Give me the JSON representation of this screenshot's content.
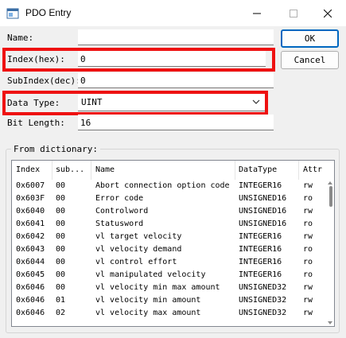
{
  "window": {
    "title": "PDO Entry"
  },
  "form": {
    "name_label": "Name:",
    "name_value": "",
    "index_label": "Index(hex):",
    "index_value": "0",
    "subindex_label": "SubIndex(dec):",
    "subindex_value": "0",
    "datatype_label": "Data Type:",
    "datatype_value": "UINT",
    "bitlength_label": "Bit Length:",
    "bitlength_value": "16"
  },
  "buttons": {
    "ok": "OK",
    "cancel": "Cancel"
  },
  "dictionary": {
    "group_title": "From dictionary:",
    "columns": [
      "Index",
      "sub...",
      "Name",
      "DataType",
      "Attr"
    ],
    "rows": [
      [
        "0x6007",
        "00",
        "Abort connection option code",
        "INTEGER16",
        "rw"
      ],
      [
        "0x603F",
        "00",
        "Error code",
        "UNSIGNED16",
        "ro"
      ],
      [
        "0x6040",
        "00",
        "Controlword",
        "UNSIGNED16",
        "rw"
      ],
      [
        "0x6041",
        "00",
        "Statusword",
        "UNSIGNED16",
        "ro"
      ],
      [
        "0x6042",
        "00",
        "vl target velocity",
        "INTEGER16",
        "rw"
      ],
      [
        "0x6043",
        "00",
        "vl velocity demand",
        "INTEGER16",
        "ro"
      ],
      [
        "0x6044",
        "00",
        "vl control effort",
        "INTEGER16",
        "ro"
      ],
      [
        "0x6045",
        "00",
        "vl manipulated velocity",
        "INTEGER16",
        "ro"
      ],
      [
        "0x6046",
        "00",
        "vl velocity min max amount",
        "UNSIGNED32",
        "rw"
      ],
      [
        "0x6046",
        "01",
        "vl velocity min amount",
        "UNSIGNED32",
        "rw"
      ],
      [
        "0x6046",
        "02",
        "vl velocity max amount",
        "UNSIGNED32",
        "rw"
      ]
    ]
  },
  "icons": {
    "app": "app-window-icon",
    "minimize": "minimize-icon",
    "maximize": "maximize-icon",
    "close": "close-icon",
    "dropdown": "chevron-down-icon"
  },
  "colors": {
    "highlight": "#ee1111",
    "ok_border": "#0067c0"
  }
}
